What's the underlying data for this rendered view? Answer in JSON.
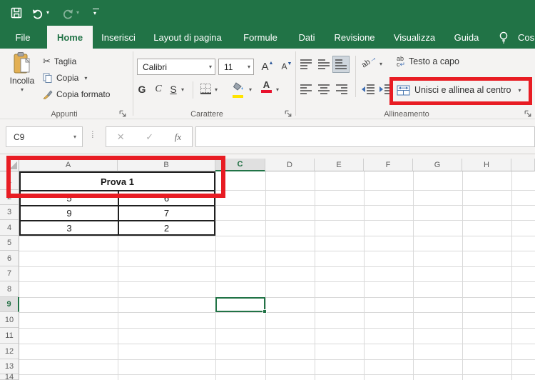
{
  "window": {
    "qat": {
      "save": "save",
      "undo": "undo",
      "redo": "redo",
      "customize": "customize-quick-access-toolbar"
    }
  },
  "tabs": {
    "items": [
      "File",
      "Home",
      "Inserisci",
      "Layout di pagina",
      "Formule",
      "Dati",
      "Revisione",
      "Visualizza",
      "Guida"
    ],
    "active": "Home",
    "tell_me": "Cos"
  },
  "ribbon": {
    "clipboard": {
      "label": "Appunti",
      "paste": "Incolla",
      "cut": "Taglia",
      "copy": "Copia",
      "format_painter": "Copia formato"
    },
    "font": {
      "label": "Carattere",
      "family": "Calibri",
      "size": "11",
      "bold": "G",
      "italic": "C",
      "underline": "S"
    },
    "alignment": {
      "label": "Allineamento",
      "wrap_text": "Testo a capo",
      "merge_center": "Unisci e allinea al centro"
    }
  },
  "formula_bar": {
    "name_box": "C9",
    "cancel": "✕",
    "enter": "✓",
    "fx_label": "fx",
    "formula": ""
  },
  "sheet": {
    "columns": [
      "A",
      "B",
      "C",
      "D",
      "E",
      "F",
      "G",
      "H",
      ""
    ],
    "rows": [
      "1",
      "2",
      "3",
      "4",
      "5",
      "6",
      "7",
      "8",
      "9",
      "10",
      "11",
      "12",
      "13",
      "14"
    ],
    "selected": {
      "cell": "C9",
      "column": "C",
      "row": "9"
    },
    "merged_cell": {
      "range": "A1:B1",
      "text": "Prova 1"
    },
    "values": {
      "A2": "5",
      "B2": "6",
      "A3": "9",
      "B3": "7",
      "A4": "3",
      "B4": "2"
    }
  },
  "annotations": {
    "color": "#e81c23",
    "targets": [
      "merged-cells-region",
      "merge-and-center-button"
    ]
  },
  "colors": {
    "excel_green": "#217346",
    "annotation_red": "#e81c23",
    "selection_green": "#217346"
  }
}
